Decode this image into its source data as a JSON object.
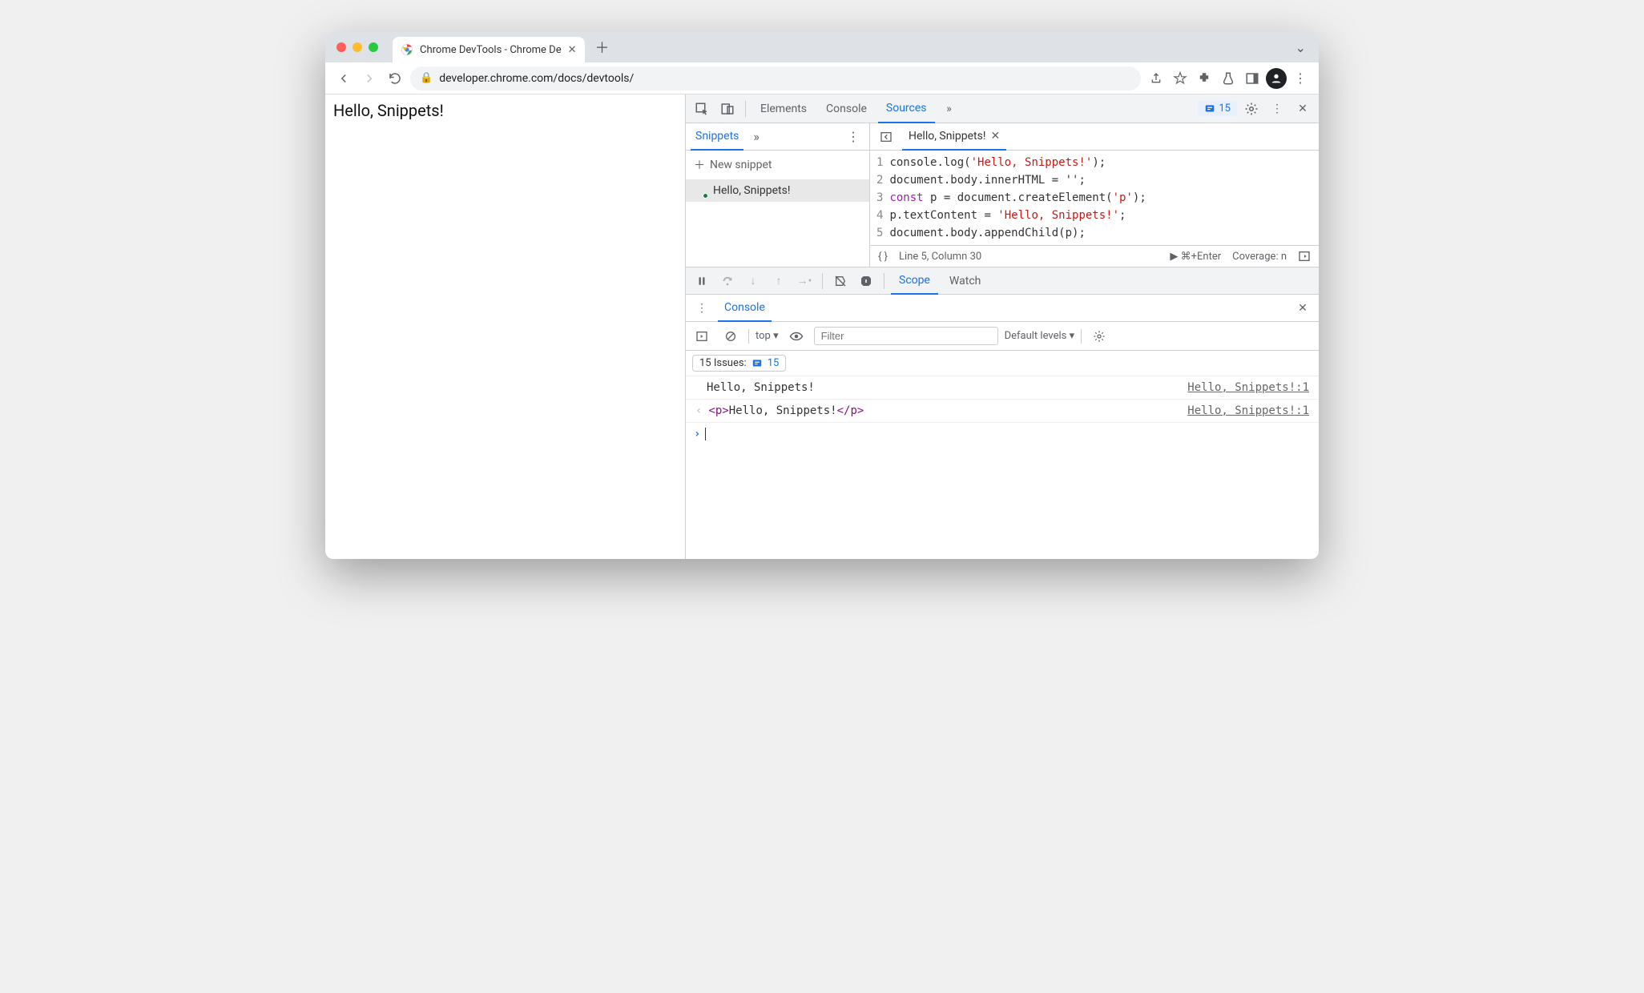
{
  "browser": {
    "tab_title": "Chrome DevTools - Chrome De",
    "url": "developer.chrome.com/docs/devtools/"
  },
  "page": {
    "body_text": "Hello, Snippets!"
  },
  "devtools": {
    "tabs": {
      "elements": "Elements",
      "console": "Console",
      "sources": "Sources"
    },
    "issues_count": "15"
  },
  "snippets": {
    "tab_label": "Snippets",
    "new_label": "New snippet",
    "item_name": "Hello, Snippets!"
  },
  "editor": {
    "tab_name": "Hello, Snippets!",
    "lines": {
      "l1a": "console.log(",
      "l1b": "'Hello, Snippets!'",
      "l1c": ");",
      "l2": "document.body.innerHTML = '';",
      "l3a": "const",
      "l3b": " p = document.createElement(",
      "l3c": "'p'",
      "l3d": ");",
      "l4a": "p.textContent = ",
      "l4b": "'Hello, Snippets!'",
      "l4c": ";",
      "l5": "document.body.appendChild(p);"
    },
    "line_numbers": {
      "n1": "1",
      "n2": "2",
      "n3": "3",
      "n4": "4",
      "n5": "5"
    },
    "status": {
      "pos": "Line 5, Column 30",
      "run": "▶ ⌘+Enter",
      "coverage": "Coverage: n"
    }
  },
  "debugger": {
    "scope": "Scope",
    "watch": "Watch"
  },
  "console_drawer": {
    "label": "Console",
    "context": "top ▾",
    "filter_placeholder": "Filter",
    "levels": "Default levels ▾",
    "issues_label": "15 Issues:",
    "issues_badge": "15",
    "rows": {
      "r1_msg": "Hello, Snippets!",
      "r1_src": "Hello, Snippets!:1",
      "r2_open": "<p>",
      "r2_txt": "Hello, Snippets!",
      "r2_close": "</p>",
      "r2_src": "Hello, Snippets!:1"
    }
  }
}
